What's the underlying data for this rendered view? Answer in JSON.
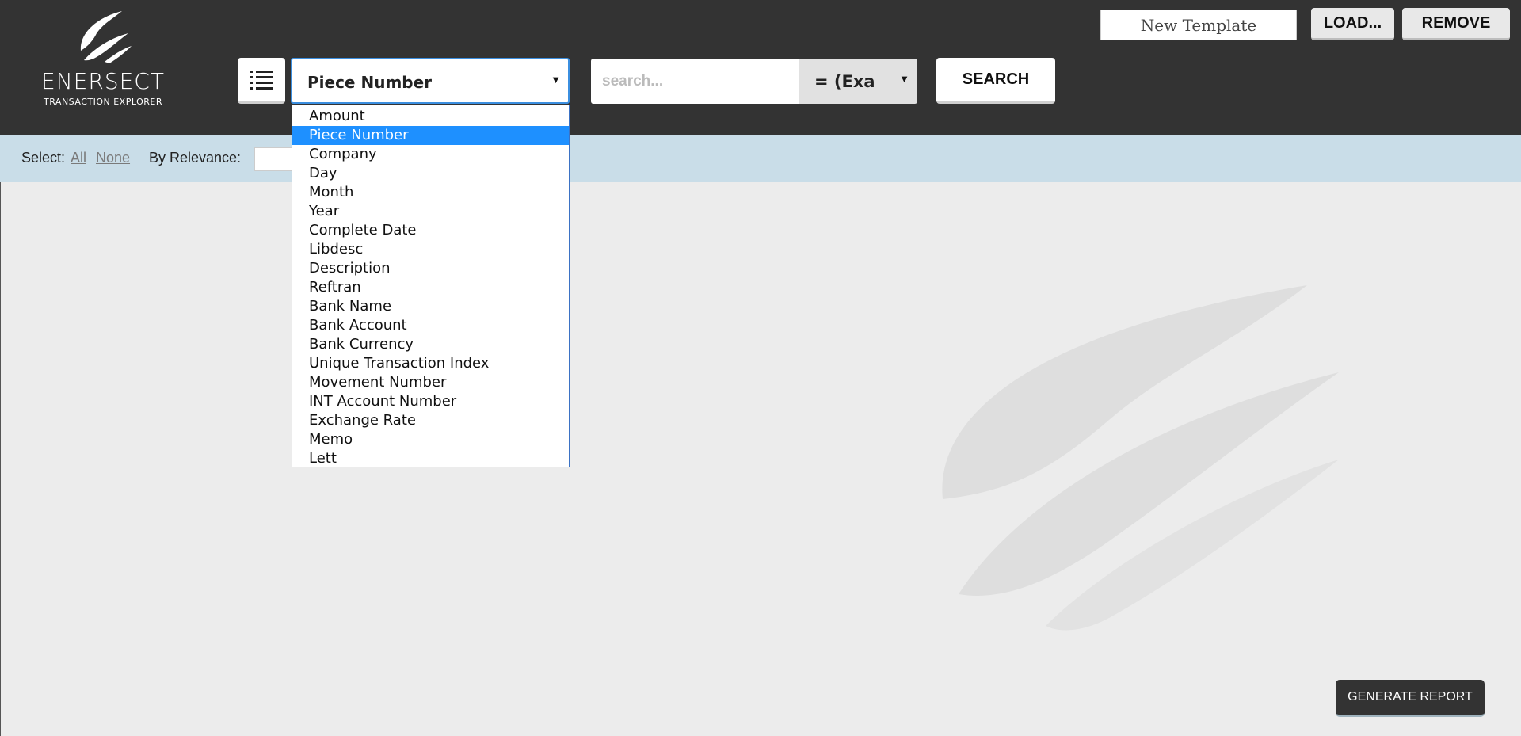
{
  "header": {
    "brand": "ENERSECT",
    "brand_sub": "TRANSACTION EXPLORER",
    "field_select": {
      "value": "Piece Number"
    },
    "search": {
      "placeholder": "search...",
      "value": ""
    },
    "operator_select": {
      "value": "= (Exa"
    },
    "search_label": "SEARCH",
    "template_name": "New Template",
    "load_label": "LOAD...",
    "remove_label": "REMOVE"
  },
  "toolbar": {
    "select_label": "Select:",
    "all_label": "All",
    "none_label": "None",
    "relevance_label": "By Relevance:"
  },
  "dropdown": {
    "selected": "Piece Number",
    "options": [
      "Amount",
      "Piece Number",
      "Company",
      "Day",
      "Month",
      "Year",
      "Complete Date",
      "Libdesc",
      "Description",
      "Reftran",
      "Bank Name",
      "Bank Account",
      "Bank Currency",
      "Unique Transaction Index",
      "Movement Number",
      "INT Account Number",
      "Exchange Rate",
      "Memo",
      "Lett"
    ]
  },
  "report_label": "GENERATE REPORT",
  "colors": {
    "header_bg": "#333333",
    "toolbar_bg": "#c9dde8",
    "page_bg": "#ececec",
    "selection": "#1e90ff"
  },
  "icons": [
    "enersect-logo",
    "list-icon",
    "watermark-logo"
  ]
}
